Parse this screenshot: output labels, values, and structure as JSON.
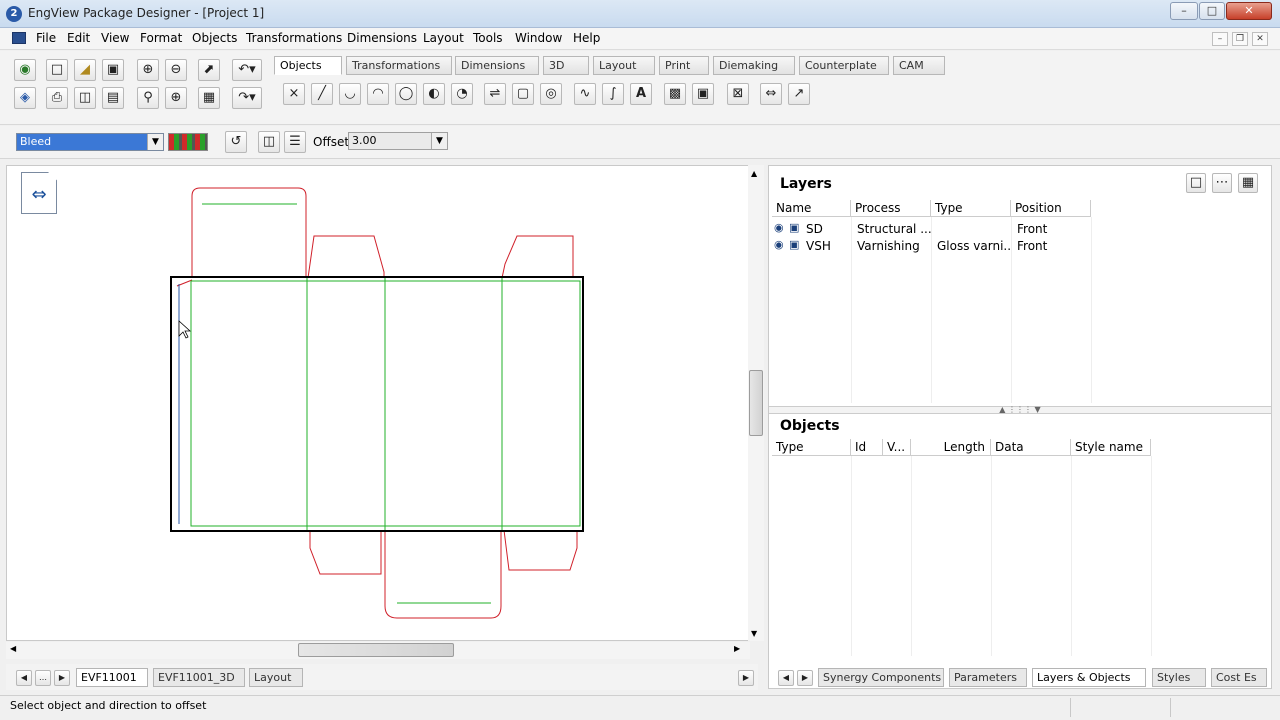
{
  "app": {
    "title": "EngView Package Designer - [Project 1]",
    "logo_letter": "2"
  },
  "menu": [
    "File",
    "Edit",
    "View",
    "Format",
    "Objects",
    "Transformations",
    "Dimensions",
    "Layout",
    "Tools",
    "Window",
    "Help"
  ],
  "toolbar_tabs": [
    "Objects",
    "Transformations",
    "Dimensions",
    "3D",
    "Layout",
    "Print",
    "Diemaking",
    "Counterplate",
    "CAM"
  ],
  "options": {
    "style_value": "Bleed",
    "offset_label": "Offset:",
    "offset_value": "3.00"
  },
  "doc_tabs": [
    "EVF11001",
    "EVF11001_3D",
    "Layout"
  ],
  "layers": {
    "title": "Layers",
    "columns": [
      "Name",
      "Process",
      "Type",
      "Position"
    ],
    "rows": [
      {
        "name": "SD",
        "process": "Structural ...",
        "type": "",
        "position": "Front"
      },
      {
        "name": "VSH",
        "process": "Varnishing",
        "type": "Gloss varni...",
        "position": "Front"
      }
    ]
  },
  "objects": {
    "title": "Objects",
    "columns": [
      "Type",
      "Id",
      "V...",
      "Length",
      "Data",
      "Style name"
    ]
  },
  "panel_tabs": [
    "Synergy Components",
    "Parameters",
    "Layers & Objects",
    "Styles",
    "Cost Es"
  ],
  "status": {
    "text": "Select object and direction to offset"
  },
  "colors": {
    "cut_line": "#d0202a",
    "crease_line": "#22b22a",
    "bleed_outline": "#000000"
  }
}
